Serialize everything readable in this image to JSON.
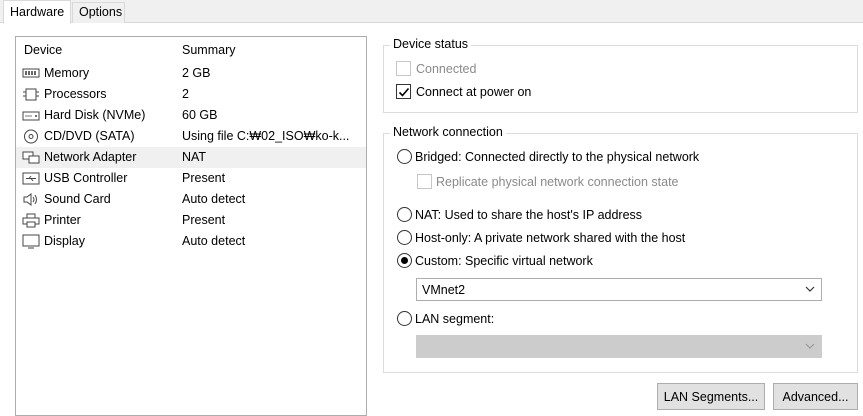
{
  "tabs": {
    "hardware": "Hardware",
    "options": "Options"
  },
  "device_list": {
    "headers": {
      "device": "Device",
      "summary": "Summary"
    },
    "rows": [
      {
        "name": "Memory",
        "summary": "2 GB",
        "icon": "memory-icon"
      },
      {
        "name": "Processors",
        "summary": "2",
        "icon": "processor-icon"
      },
      {
        "name": "Hard Disk (NVMe)",
        "summary": "60 GB",
        "icon": "hard-disk-icon"
      },
      {
        "name": "CD/DVD (SATA)",
        "summary": "Using file C:₩02_ISO₩ko-k...",
        "icon": "cd-dvd-icon"
      },
      {
        "name": "Network Adapter",
        "summary": "NAT",
        "icon": "network-adapter-icon"
      },
      {
        "name": "USB Controller",
        "summary": "Present",
        "icon": "usb-icon"
      },
      {
        "name": "Sound Card",
        "summary": "Auto detect",
        "icon": "speaker-icon"
      },
      {
        "name": "Printer",
        "summary": "Present",
        "icon": "printer-icon"
      },
      {
        "name": "Display",
        "summary": "Auto detect",
        "icon": "display-icon"
      }
    ],
    "selected_index": 4
  },
  "device_status": {
    "title": "Device status",
    "connected": "Connected",
    "connected_checked": false,
    "connect_at_power_on": "Connect at power on",
    "connect_at_power_on_checked": true
  },
  "network_connection": {
    "title": "Network connection",
    "bridged": "Bridged: Connected directly to the physical network",
    "replicate": "Replicate physical network connection state",
    "nat": "NAT: Used to share the host's IP address",
    "host_only": "Host-only: A private network shared with the host",
    "custom": "Custom: Specific virtual network",
    "custom_value": "VMnet2",
    "lan_segment": "LAN segment:",
    "lan_segment_value": "",
    "selected": "custom"
  },
  "buttons": {
    "lan_segments": "LAN Segments...",
    "advanced": "Advanced..."
  }
}
